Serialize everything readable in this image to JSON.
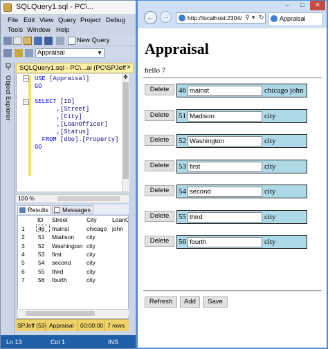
{
  "ssms": {
    "title": "SQLQuery1.sql - PC\\...",
    "menu": [
      "File",
      "Edit",
      "View",
      "Query",
      "Project",
      "Debug",
      "Tools",
      "Window",
      "Help"
    ],
    "new_query_label": "New Query",
    "database": "Appraisal",
    "object_explorer_label": "Object Explorer",
    "doc_tab": "SQLQuery1.sql - PC\\...al (PC\\SPJeff",
    "code": {
      "use_kw": "USE",
      "use_db": "[Appraisal]",
      "go1": "GO",
      "select_kw": "SELECT",
      "col_id": "[ID]",
      "col_street": ",[Street]",
      "col_city": ",[City]",
      "col_loan": ",[LoanOfficer]",
      "col_status": ",[Status]",
      "from_kw": "FROM",
      "from_table": "[dbo].[Property]",
      "go2": "GO"
    },
    "zoom": "100 %",
    "result_tabs": [
      "Results",
      "Messages"
    ],
    "grid": {
      "columns": [
        "ID",
        "Street",
        "City",
        "LoanO"
      ],
      "rows": [
        {
          "n": "1",
          "id": "46",
          "street": "mainst",
          "city": "chicago",
          "loan": "john"
        },
        {
          "n": "2",
          "id": "51",
          "street": "Madison",
          "city": "city",
          "loan": ""
        },
        {
          "n": "3",
          "id": "52",
          "street": "Washington",
          "city": "city",
          "loan": ""
        },
        {
          "n": "4",
          "id": "53",
          "street": "first",
          "city": "city",
          "loan": ""
        },
        {
          "n": "5",
          "id": "54",
          "street": "second",
          "city": "city",
          "loan": ""
        },
        {
          "n": "6",
          "id": "55",
          "street": "third",
          "city": "city",
          "loan": ""
        },
        {
          "n": "7",
          "id": "56",
          "street": "fourth",
          "city": "city",
          "loan": ""
        }
      ]
    },
    "exec_status": {
      "user": "SPJeff (53)",
      "db": "Appraisal",
      "time": "00:00:00",
      "rows": "7 rows"
    },
    "status_bar": {
      "ln": "Ln 13",
      "col": "Col 1",
      "ins": "INS"
    }
  },
  "ie": {
    "url": "http://localhost:2304/",
    "tab_title": "Appraisal",
    "heading": "Appraisal",
    "hello": "hello 7",
    "delete_label": "Delete",
    "records": [
      {
        "id": "46",
        "street": "mainst",
        "city": "chicago john"
      },
      {
        "id": "51",
        "street": "Madison",
        "city": "city"
      },
      {
        "id": "52",
        "street": "Washington",
        "city": "city"
      },
      {
        "id": "53",
        "street": "first",
        "city": "city"
      },
      {
        "id": "54",
        "street": "second",
        "city": "city"
      },
      {
        "id": "55",
        "street": "third",
        "city": "city"
      },
      {
        "id": "56",
        "street": "fourth",
        "city": "city"
      }
    ],
    "actions": {
      "refresh": "Refresh",
      "add": "Add",
      "save": "Save"
    }
  }
}
